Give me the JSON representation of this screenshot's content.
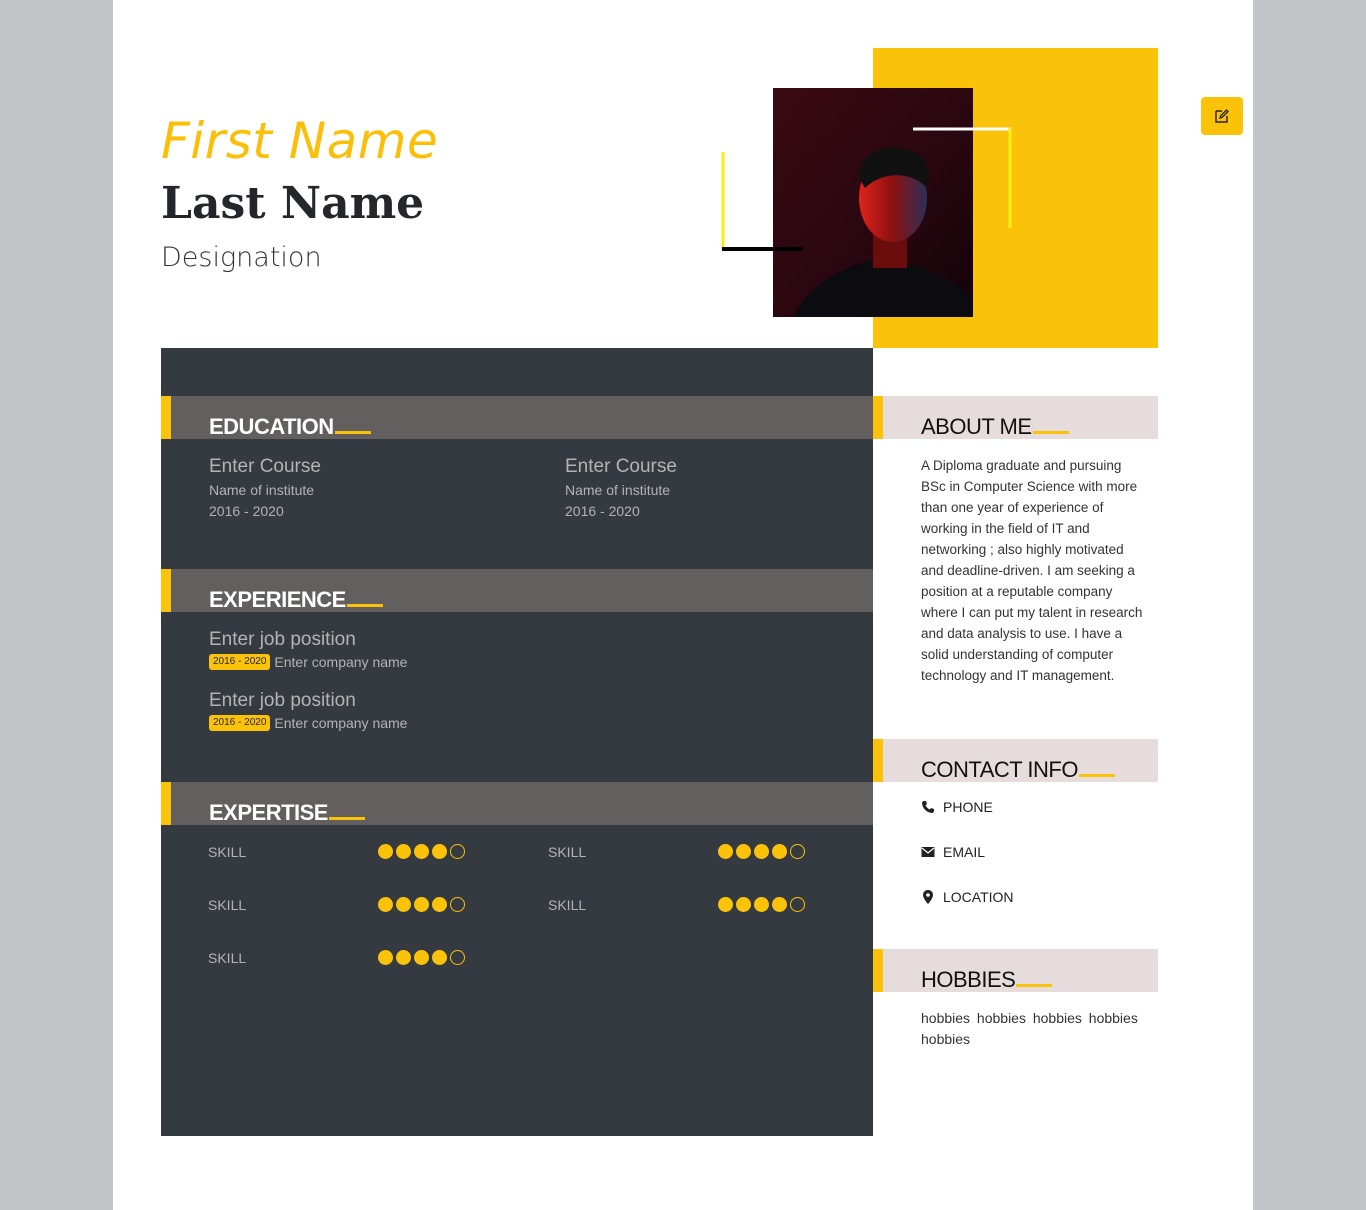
{
  "header": {
    "first_name": "First Name",
    "last_name": "Last Name",
    "designation": "Designation"
  },
  "toolbar": {
    "edit_icon": "edit-icon"
  },
  "colors": {
    "accent": "#fbc20a",
    "dark_panel": "#353a40",
    "section_bar": "#625f5e",
    "side_bar": "#e6dcdb"
  },
  "education": {
    "title": "EDUCATION",
    "items": [
      {
        "course": "Enter Course",
        "institute": "Name of institute",
        "years": "2016 - 2020"
      },
      {
        "course": "Enter Course",
        "institute": "Name of institute",
        "years": "2016 - 2020"
      }
    ]
  },
  "experience": {
    "title": "EXPERIENCE",
    "items": [
      {
        "position": "Enter job position",
        "years": "2016 - 2020",
        "company": "Enter company name"
      },
      {
        "position": "Enter job position",
        "years": "2016 - 2020",
        "company": "Enter company name"
      }
    ]
  },
  "expertise": {
    "title": "EXPERTISE",
    "skills": [
      {
        "name": "SKILL",
        "rating": 4,
        "max": 5
      },
      {
        "name": "SKILL",
        "rating": 4,
        "max": 5
      },
      {
        "name": "SKILL",
        "rating": 4,
        "max": 5
      },
      {
        "name": "SKILL",
        "rating": 4,
        "max": 5
      },
      {
        "name": "SKILL",
        "rating": 4,
        "max": 5
      }
    ]
  },
  "about": {
    "title": "ABOUT ME",
    "text": "A Diploma graduate and pursuing BSc in Computer Science with more than one year of experience of working in the field of IT and networking ; also highly motivated and deadline-driven. I am seeking a position at a reputable company where I can put my talent in research and data analysis to use. I have a solid understanding of computer technology and IT management."
  },
  "contact": {
    "title": "CONTACT INFO",
    "items": [
      {
        "icon": "phone-icon",
        "label": "PHONE"
      },
      {
        "icon": "envelope-icon",
        "label": "EMAIL"
      },
      {
        "icon": "location-pin-icon",
        "label": "LOCATION"
      }
    ]
  },
  "hobbies": {
    "title": "HOBBIES",
    "text": "hobbies hobbies hobbies hobbies hobbies"
  }
}
